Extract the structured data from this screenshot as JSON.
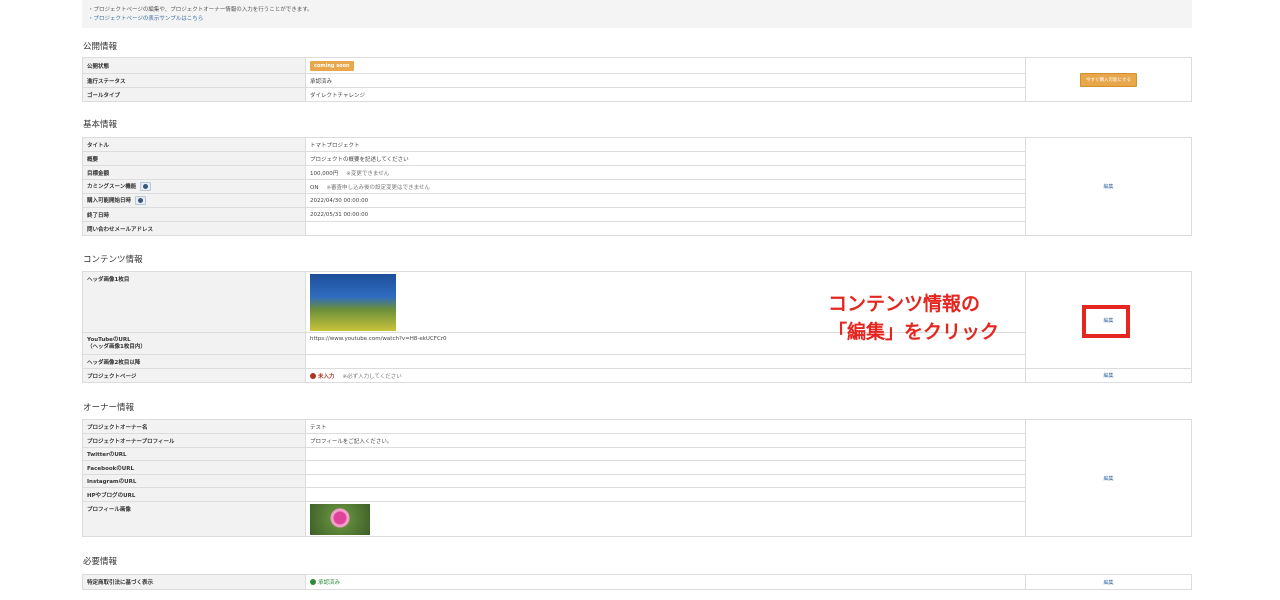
{
  "notice": {
    "line1": "・プロジェクトページの編集や、プロジェクトオーナー情報の入力を行うことができます。",
    "line2": "・プロジェクトページの表示サンプルはこちら"
  },
  "publish": {
    "heading": "公開情報",
    "rows": [
      {
        "label": "公開状態",
        "value": "coming soon"
      },
      {
        "label": "進行ステータス",
        "value": "承認済み"
      },
      {
        "label": "ゴールタイプ",
        "value": "ダイレクトチャレンジ"
      }
    ],
    "action": "今すぐ購入可能にする"
  },
  "basic": {
    "heading": "基本情報",
    "rows": [
      {
        "label": "タイトル",
        "value": "トマトプロジェクト",
        "note": ""
      },
      {
        "label": "概要",
        "value": "プロジェクトの概要を記述してください",
        "note": ""
      },
      {
        "label": "目標金額",
        "value": "100,000円",
        "note": "※変更できません"
      },
      {
        "label": "カミングスーン機能",
        "value": "ON",
        "note": "※審査申し込み後の設定変更はできません"
      },
      {
        "label": "購入可能開始日時",
        "value": "2022/04/30 00:00:00",
        "note": ""
      },
      {
        "label": "終了日時",
        "value": "2022/05/31 00:00:00",
        "note": ""
      },
      {
        "label": "問い合わせメールアドレス",
        "value": "",
        "note": ""
      }
    ],
    "edit": "編集"
  },
  "contents": {
    "heading": "コンテンツ情報",
    "rows": [
      {
        "label": "ヘッダ画像1枚目"
      },
      {
        "label": "YouTubeのURL\n（ヘッダ画像1枚目内）",
        "value": "https://www.youtube.com/watch?v=H8-ekUCFCr0"
      },
      {
        "label": "ヘッダ画像2枚目以降",
        "value": ""
      },
      {
        "label": "プロジェクトページ",
        "value": "未入力",
        "note": "※必ず入力してください"
      }
    ],
    "edit1": "編集",
    "edit2": "編集"
  },
  "owner": {
    "heading": "オーナー情報",
    "rows": [
      {
        "label": "プロジェクトオーナー名",
        "value": "テスト"
      },
      {
        "label": "プロジェクトオーナープロフィール",
        "value": "プロフィールをご記入ください。"
      },
      {
        "label": "TwitterのURL",
        "value": ""
      },
      {
        "label": "FacebookのURL",
        "value": ""
      },
      {
        "label": "InstagramのURL",
        "value": ""
      },
      {
        "label": "HPやブログのURL",
        "value": ""
      },
      {
        "label": "プロフィール画像"
      }
    ],
    "edit": "編集"
  },
  "required": {
    "heading": "必要情報",
    "rows": [
      {
        "label": "特定商取引法に基づく表示",
        "value": "承認済み"
      }
    ],
    "edit": "編集"
  },
  "annotation": {
    "line1": "コンテンツ情報の",
    "line2": "「編集」をクリック"
  },
  "colors": {
    "accent_orange": "#e8a74a",
    "link_blue": "#3a6ea5",
    "annotation_red": "#e5251f"
  }
}
